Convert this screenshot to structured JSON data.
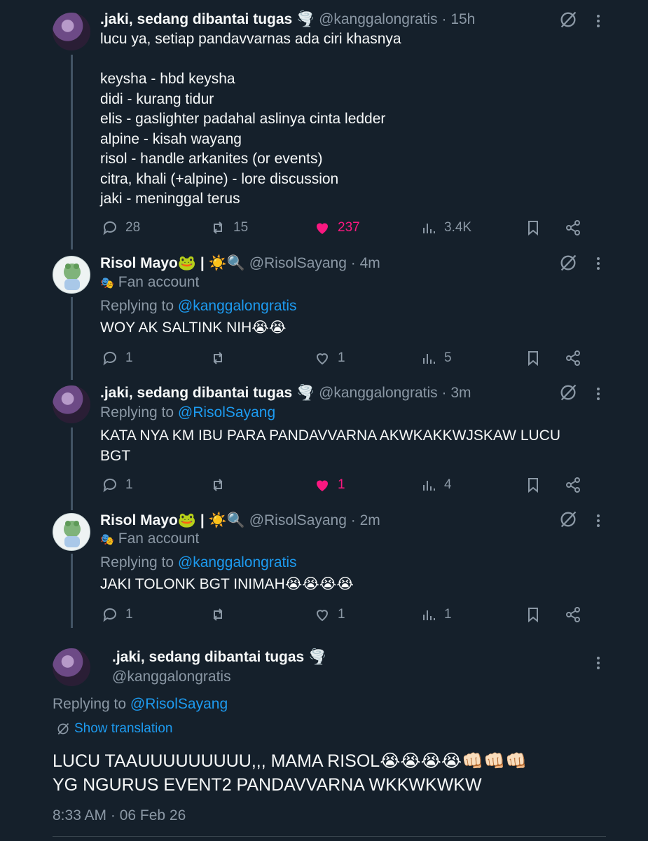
{
  "colors": {
    "background": "#15202b",
    "text": "#f7f9f9",
    "muted": "#8b98a5",
    "link": "#1d9bf0",
    "like": "#f91880"
  },
  "tweets": [
    {
      "name": ".jaki, sedang dibantai tugas 🌪️",
      "handle": "@kanggalongratis",
      "time": "· 15h",
      "lines": [
        "lucu ya, setiap pandavvarnas ada ciri khasnya",
        "",
        "keysha - hbd keysha",
        "didi - kurang tidur",
        "elis - gaslighter padahal aslinya cinta ledder",
        "alpine - kisah wayang",
        "risol - handle arkanites (or events)",
        "citra, khali (+alpine) - lore discussion",
        "jaki - meninggal terus"
      ],
      "replies": "28",
      "reposts": "15",
      "likes": "237",
      "views": "3.4K",
      "liked": true
    },
    {
      "name": "Risol Mayo🐸 | ☀️🔍",
      "handle": "@RisolSayang",
      "time": "· 4m",
      "label": "Fan account",
      "replying_prefix": "Replying to ",
      "replying_to": "@kanggalongratis",
      "lines": [
        "WOY AK SALTINK NIH😭😭"
      ],
      "replies": "1",
      "reposts": "",
      "likes": "1",
      "views": "5",
      "liked": false
    },
    {
      "name": ".jaki, sedang dibantai tugas 🌪️",
      "handle": "@kanggalongratis",
      "time": "· 3m",
      "replying_prefix": "Replying to ",
      "replying_to": "@RisolSayang",
      "lines": [
        "KATA NYA KM IBU PARA PANDAVVARNA AKWKAKKWJSKAW LUCU",
        "BGT"
      ],
      "replies": "1",
      "reposts": "",
      "likes": "1",
      "views": "4",
      "liked": true
    },
    {
      "name": "Risol Mayo🐸 | ☀️🔍",
      "handle": "@RisolSayang",
      "time": "· 2m",
      "label": "Fan account",
      "replying_prefix": "Replying to ",
      "replying_to": "@kanggalongratis",
      "lines": [
        "JAKI TOLONK BGT INIMAH😭😭😭😭"
      ],
      "replies": "1",
      "reposts": "",
      "likes": "1",
      "views": "1",
      "liked": false
    }
  ],
  "main": {
    "name": ".jaki, sedang dibantai tugas 🌪️",
    "handle": "@kanggalongratis",
    "replying_prefix": "Replying to ",
    "replying_to": "@RisolSayang",
    "show_translation": "Show translation",
    "lines": [
      "LUCU TAAUUUUUUUUU,,, MAMA RISOL😭😭😭😭👊🏻👊🏻👊🏻",
      "YG NGURUS EVENT2 PANDAVVARNA WKKWKWKW"
    ],
    "timestamp": "8:33 AM · 06 Feb 26"
  }
}
